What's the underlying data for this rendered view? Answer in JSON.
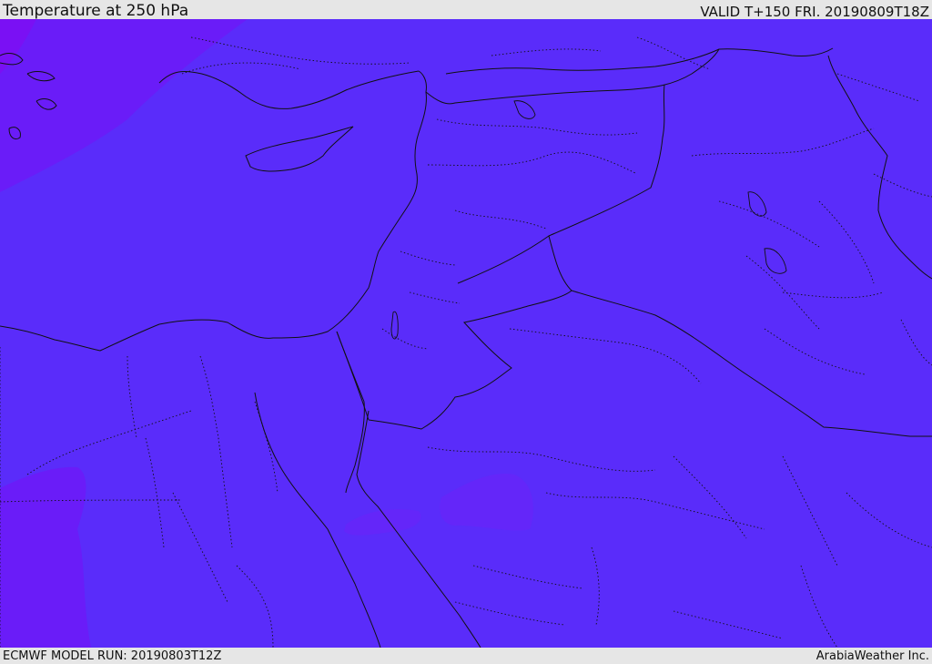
{
  "header": {
    "title": "Temperature at 250 hPa",
    "valid": "VALID T+150 FRI. 20190809T18Z"
  },
  "footer": {
    "model_run": "ECMWF MODEL RUN: 20190803T12Z",
    "credit": "ArabiaWeather Inc."
  },
  "colors": {
    "field_main": "#5a2cfa",
    "field_warm": "#6a1cf8",
    "field_warmer": "#7a10f4",
    "line": "#111111",
    "bars": "#e6e6e6"
  }
}
